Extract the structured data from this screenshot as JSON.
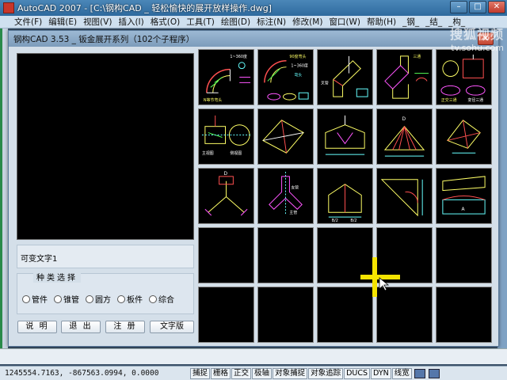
{
  "acad": {
    "title": "AutoCAD 2007 - [C:\\钢构CAD _ 轻松愉快的展开放样操作.dwg]",
    "menu": [
      "文件(F)",
      "编辑(E)",
      "视图(V)",
      "插入(I)",
      "格式(O)",
      "工具(T)",
      "绘图(D)",
      "标注(N)",
      "修改(M)",
      "窗口(W)",
      "帮助(H)",
      "_钢_",
      "_结_",
      "_构_"
    ]
  },
  "watermark": {
    "brand": "搜狐视频",
    "url": "tv.sohu.com"
  },
  "dialog": {
    "title": "钢构CAD 3.53 _ 钣金展开系列（102个子程序）",
    "caption": "可变文字1",
    "type_group_label": "种类选择",
    "type_options": [
      "管件",
      "锥管",
      "圆方",
      "板件",
      "综合"
    ],
    "buttons": {
      "help": "说 明",
      "exit": "退 出",
      "register": "注 册",
      "text_version": "文字版"
    }
  },
  "thumbnails": {
    "row1": [
      {
        "labels": [
          "N等节弯头",
          "1~360度"
        ]
      },
      {
        "labels": [
          "90度弯头",
          "1~360度",
          "弯头"
        ]
      },
      {
        "labels": [
          "叉管"
        ]
      },
      {
        "labels": [
          "三通"
        ]
      },
      {
        "labels": [
          "正交三通",
          "变径三通"
        ]
      }
    ],
    "row2": [
      {
        "labels": [
          "主视图",
          "侧视图"
        ]
      },
      {
        "labels": []
      },
      {
        "labels": []
      },
      {
        "labels": []
      },
      {
        "labels": []
      }
    ],
    "row3": [
      {
        "labels": []
      },
      {
        "labels": [
          "支管",
          "主管"
        ]
      },
      {
        "labels": []
      },
      {
        "labels": []
      },
      {
        "labels": []
      }
    ]
  },
  "statusbar": {
    "coords": "1245554.7163, -867563.0994, 0.0000",
    "toggles": [
      "捕捉",
      "栅格",
      "正交",
      "极轴",
      "对象捕捉",
      "对象追踪",
      "DUCS",
      "DYN",
      "线宽"
    ]
  }
}
